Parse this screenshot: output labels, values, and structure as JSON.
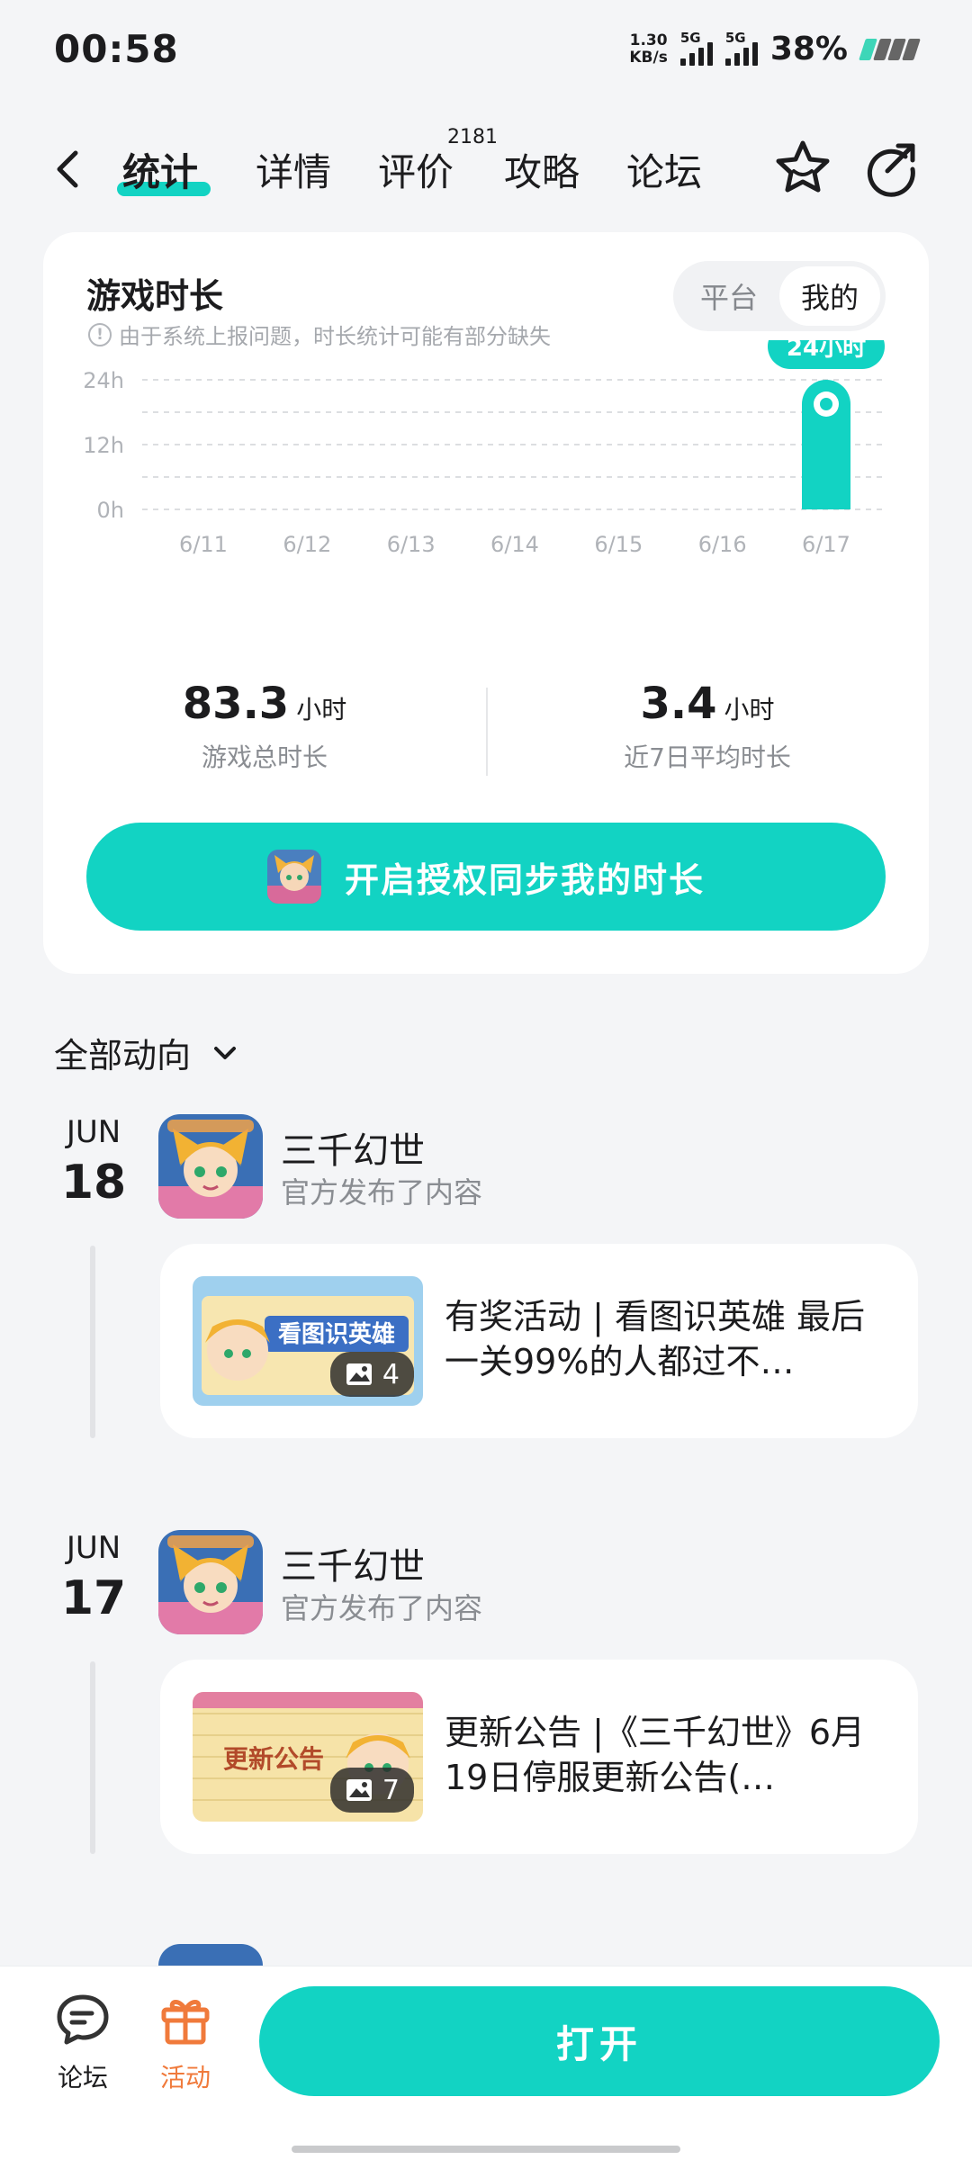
{
  "status_bar": {
    "time": "00:58",
    "net_speed_value": "1.30",
    "net_speed_unit": "KB/s",
    "sim1_label": "5G",
    "sim2_label": "5G",
    "battery_percent": "38%"
  },
  "nav": {
    "tabs": [
      {
        "label": "统计",
        "active": true
      },
      {
        "label": "详情",
        "active": false
      },
      {
        "label": "评价",
        "active": false
      },
      {
        "label": "攻略",
        "active": false
      },
      {
        "label": "论坛",
        "active": false
      }
    ],
    "reviews_count": "2181",
    "icons": [
      "back-icon",
      "star-icon",
      "share-icon"
    ]
  },
  "stats_card": {
    "title": "游戏时长",
    "note": "由于系统上报问题，时长统计可能有部分缺失",
    "toggle": {
      "options": [
        "平台",
        "我的"
      ],
      "selected": "我的"
    },
    "total_value": "83.3",
    "total_unit": "小时",
    "total_label": "游戏总时长",
    "avg_value": "3.4",
    "avg_unit": "小时",
    "avg_label": "近7日平均时长",
    "sync_button_label": "开启授权同步我的时长"
  },
  "chart_data": {
    "type": "bar",
    "categories": [
      "6/11",
      "6/12",
      "6/13",
      "6/14",
      "6/15",
      "6/16",
      "6/17"
    ],
    "values": [
      0,
      0,
      0,
      0,
      0,
      0,
      24
    ],
    "y_ticks": [
      "0h",
      "12h",
      "24h"
    ],
    "ylim": [
      0,
      24
    ],
    "grid": true,
    "highlight_index": 6,
    "highlight_label": "24小时",
    "bar_color": "#12d3c3"
  },
  "feed": {
    "filter_label": "全部动向",
    "items": [
      {
        "month": "JUN",
        "day": "18",
        "game": "三千幻世",
        "action": "官方发布了内容",
        "post_title": "有奖活动 | 看图识英雄 最后一关99%的人都过不…",
        "image_count": "4"
      },
      {
        "month": "JUN",
        "day": "17",
        "game": "三千幻世",
        "action": "官方发布了内容",
        "post_title": "更新公告 |《三千幻世》6月19日停服更新公告(…",
        "image_count": "7"
      }
    ]
  },
  "bottom_bar": {
    "forum_label": "论坛",
    "activity_label": "活动",
    "open_button_label": "打开",
    "accent": "#12d3c3",
    "activity_color": "#f07a3b"
  }
}
